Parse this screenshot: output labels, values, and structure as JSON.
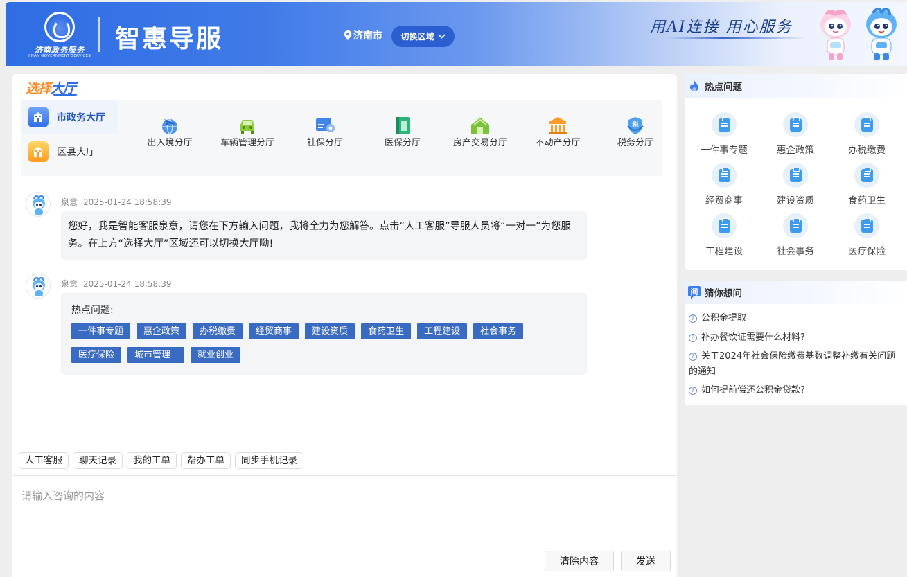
{
  "header": {
    "logo_text_cn": "济南政务服务",
    "logo_text_en": "JINAN GOVERNMENT SERVICES",
    "app_title": "智惠导服",
    "location": "济南市",
    "switch_region_label": "切换区域",
    "slogan": "用AI连接 用心服务"
  },
  "hall_selector": {
    "title_part1": "选择",
    "title_part2": "大厅",
    "side_items": [
      {
        "label": "市政务大厅",
        "active": true,
        "icon": "building-icon"
      },
      {
        "label": "区县大厅",
        "active": false,
        "icon": "building-icon"
      }
    ],
    "halls": [
      {
        "label": "出入境分厅",
        "icon": "globe-plane-icon"
      },
      {
        "label": "车辆管理分厅",
        "icon": "car-icon"
      },
      {
        "label": "社保分厅",
        "icon": "social-security-card-icon"
      },
      {
        "label": "医保分厅",
        "icon": "medical-book-icon"
      },
      {
        "label": "房产交易分厅",
        "icon": "house-icon"
      },
      {
        "label": "不动产分厅",
        "icon": "bank-icon"
      },
      {
        "label": "税务分厅",
        "icon": "tax-shield-icon"
      }
    ]
  },
  "chat": {
    "messages": [
      {
        "sender": "泉意",
        "time": "2025-01-24 18:58:39",
        "text": "您好，我是智能客服泉意，请您在下方输入问题，我将全力为您解答。点击“人工客服”导服人员将“一对一”为您服务。在上方“选择大厅”区域还可以切换大厅呦!"
      },
      {
        "sender": "泉意",
        "time": "2025-01-24 18:58:39",
        "hot_label": "热点问题:",
        "chips": [
          "一件事专题",
          "惠企政策",
          "办税缴费",
          "经贸商事",
          "建设资质",
          "食药卫生",
          "工程建设",
          "社会事务",
          "医疗保险",
          "城市管理",
          "就业创业"
        ]
      }
    ],
    "tools": [
      "人工客服",
      "聊天记录",
      "我的工单",
      "帮办工单",
      "同步手机记录"
    ],
    "input_placeholder": "请输入咨询的内容",
    "clear_label": "清除内容",
    "send_label": "发送"
  },
  "hot_panel": {
    "title": "热点问题",
    "items": [
      "一件事专题",
      "惠企政策",
      "办税缴费",
      "经贸商事",
      "建设资质",
      "食药卫生",
      "工程建设",
      "社会事务",
      "医疗保险"
    ]
  },
  "guess_panel": {
    "title": "猜你想问",
    "icon_char": "问",
    "items": [
      "公积金提取",
      "补办餐饮证需要什么材料?",
      "关于2024年社会保险缴费基数调整补缴有关问题的通知",
      "如何提前偿还公积金贷款?"
    ]
  },
  "colors": {
    "brand_blue": "#2f6de4",
    "chip_blue": "#3a6bc2",
    "accent_orange": "#ff8a24"
  }
}
